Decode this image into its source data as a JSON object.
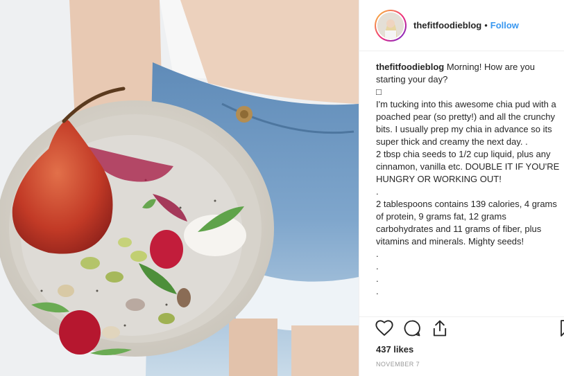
{
  "post": {
    "username": "thefitfoodieblog",
    "separator": "•",
    "follow_label": "Follow",
    "caption_username": "thefitfoodieblog",
    "caption_lines": [
      " Morning! How are you starting your day?",
      "□",
      "I'm tucking into this awesome chia pud with a poached pear (so pretty!) and all the crunchy bits. I usually prep my chia in advance so its super thick and creamy the next day. .",
      "2 tbsp chia seeds to 1/2 cup liquid, plus any cinnamon, vanilla etc. DOUBLE IT IF YOU'RE HUNGRY OR WORKING OUT!",
      ".",
      "2 tablespoons contains 139 calories, 4 grams of protein, 9 grams fat, 12 grams carbohydrates and 11 grams of fiber, plus vitamins and minerals. Mighty seeds!",
      ".",
      ".",
      ".",
      "."
    ],
    "likes": "437 likes",
    "date": "NOVEMBER 7"
  },
  "icons": {
    "like": "heart-icon",
    "comment": "comment-icon",
    "share": "share-icon",
    "save": "bookmark-icon"
  },
  "colors": {
    "follow_blue": "#3897f0",
    "text": "#262626",
    "muted": "#999999",
    "divider": "#efefef"
  }
}
